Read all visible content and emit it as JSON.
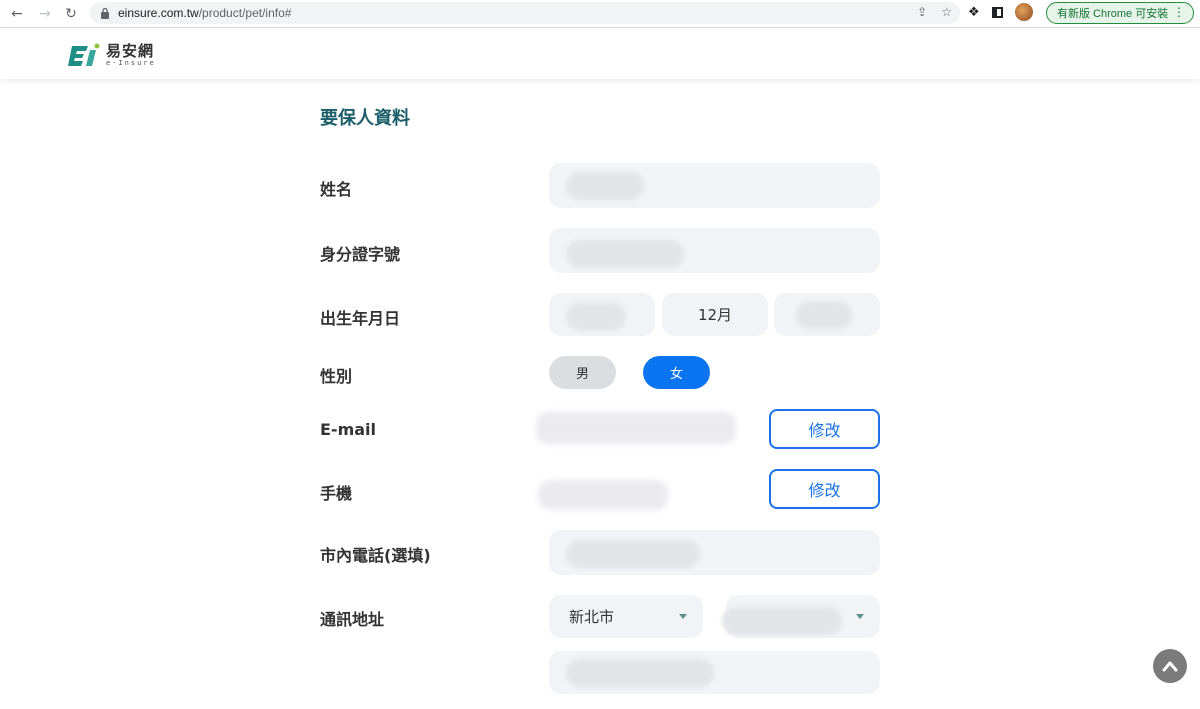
{
  "browser": {
    "url_host": "einsure.com.tw",
    "url_path": "/product/pet/info#",
    "install_label": "有新版 Chrome 可安裝"
  },
  "site": {
    "logo_zh": "易安網",
    "logo_en": "e-Insure"
  },
  "form": {
    "section_title": "要保人資料",
    "labels": {
      "name": "姓名",
      "id_number": "身分證字號",
      "birthdate": "出生年月日",
      "gender": "性別",
      "email": "E-mail",
      "mobile": "手機",
      "landline": "市內電話(選填)",
      "address": "通訊地址"
    },
    "birth_month": "12月",
    "gender_options": [
      "男",
      "女"
    ],
    "gender_selected": "女",
    "edit_label": "修改",
    "city": "新北市"
  },
  "colors": {
    "section_title": "#1c5f6a",
    "primary_blue": "#0b74f1",
    "field_bg": "#f2f3f7"
  }
}
